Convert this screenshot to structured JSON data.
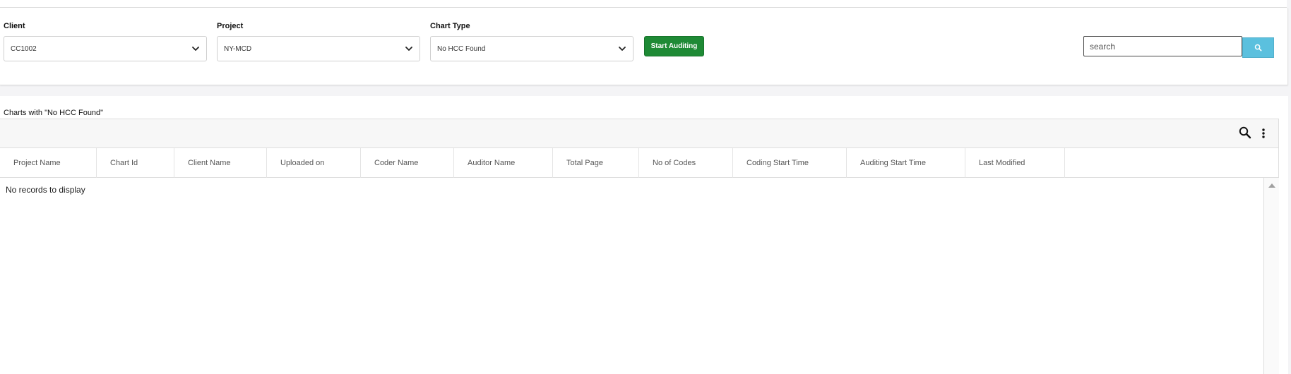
{
  "filters": {
    "client": {
      "label": "Client",
      "value": "CC1002"
    },
    "project": {
      "label": "Project",
      "value": "NY-MCD"
    },
    "chart_type": {
      "label": "Chart Type",
      "value": "No HCC Found"
    },
    "start_button": "Start Auditing",
    "search": {
      "placeholder": "search"
    }
  },
  "grid": {
    "title": "Charts with \"No HCC Found\"",
    "columns": [
      "Project Name",
      "Chart Id",
      "Client Name",
      "Uploaded on",
      "Coder Name",
      "Auditor Name",
      "Total Page",
      "No of Codes",
      "Coding Start Time",
      "Auditing Start Time",
      "Last Modified"
    ],
    "empty_message": "No records to display"
  },
  "colors": {
    "primary_button": "#1e8a35",
    "search_button": "#5bc0de"
  },
  "icons": {
    "dropdown": "chevron-down-icon",
    "search": "search-icon",
    "more": "more-vertical-icon",
    "scroll_up": "scroll-up-arrow"
  }
}
